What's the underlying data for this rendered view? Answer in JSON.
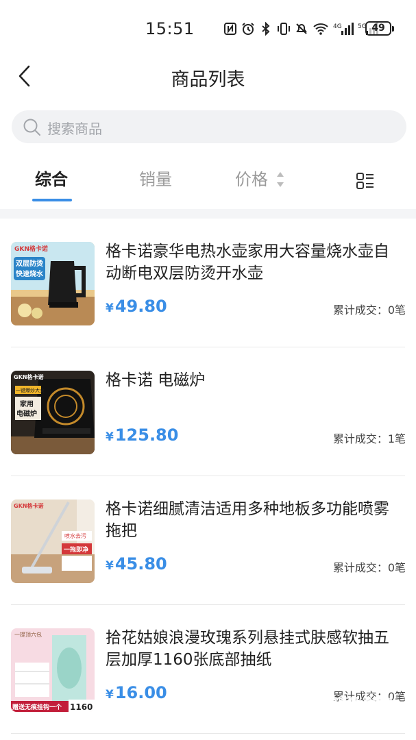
{
  "status_bar": {
    "time": "15:51",
    "battery": "49",
    "icons": [
      "nfc-icon",
      "alarm-icon",
      "bluetooth-icon",
      "vibrate-icon",
      "mute-icon",
      "wifi-icon",
      "signal-4g-icon",
      "signal-5g-icon"
    ]
  },
  "nav": {
    "title": "商品列表"
  },
  "search": {
    "placeholder": "搜索商品"
  },
  "tabs": {
    "comprehensive": "综合",
    "sales": "销量",
    "price": "价格"
  },
  "colors": {
    "accent": "#3a8ee6",
    "text": "#222222",
    "muted": "#9a9a9a",
    "search_bg": "#f1f2f4"
  },
  "products": [
    {
      "name": "格卡诺豪华电热水壶家用大容量烧水壶自动断电双层防烫开水壶",
      "currency": "¥",
      "price": "49.80",
      "sold": "累计成交：0笔",
      "image_text": [
        "GKN格卡诺",
        "双层防烫",
        "快速烧水"
      ]
    },
    {
      "name": "格卡诺 电磁炉",
      "currency": "¥",
      "price": "125.80",
      "sold": "累计成交：1笔",
      "image_text": [
        "GKN格卡诺",
        "一键爆炒大火",
        "家用",
        "电磁炉"
      ]
    },
    {
      "name": "格卡诺细腻清洁适用多种地板多功能喷雾拖把",
      "currency": "¥",
      "price": "45.80",
      "sold": "累计成交：0笔",
      "image_text": [
        "GKN格卡诺",
        "喷水去污",
        "一拖即净"
      ]
    },
    {
      "name": "拾花姑娘浪漫玫瑰系列悬挂式肤感软抽五层加厚1160张底部抽纸",
      "currency": "¥",
      "price": "16.00",
      "sold": "累计成交：0笔",
      "image_text": [
        "一提顶六包",
        "赠送无痕挂钩一个",
        "1160"
      ]
    }
  ],
  "watermark": {
    "brand": "硬件之家",
    "url": "YING JIAN ZHI JIA.COM"
  }
}
